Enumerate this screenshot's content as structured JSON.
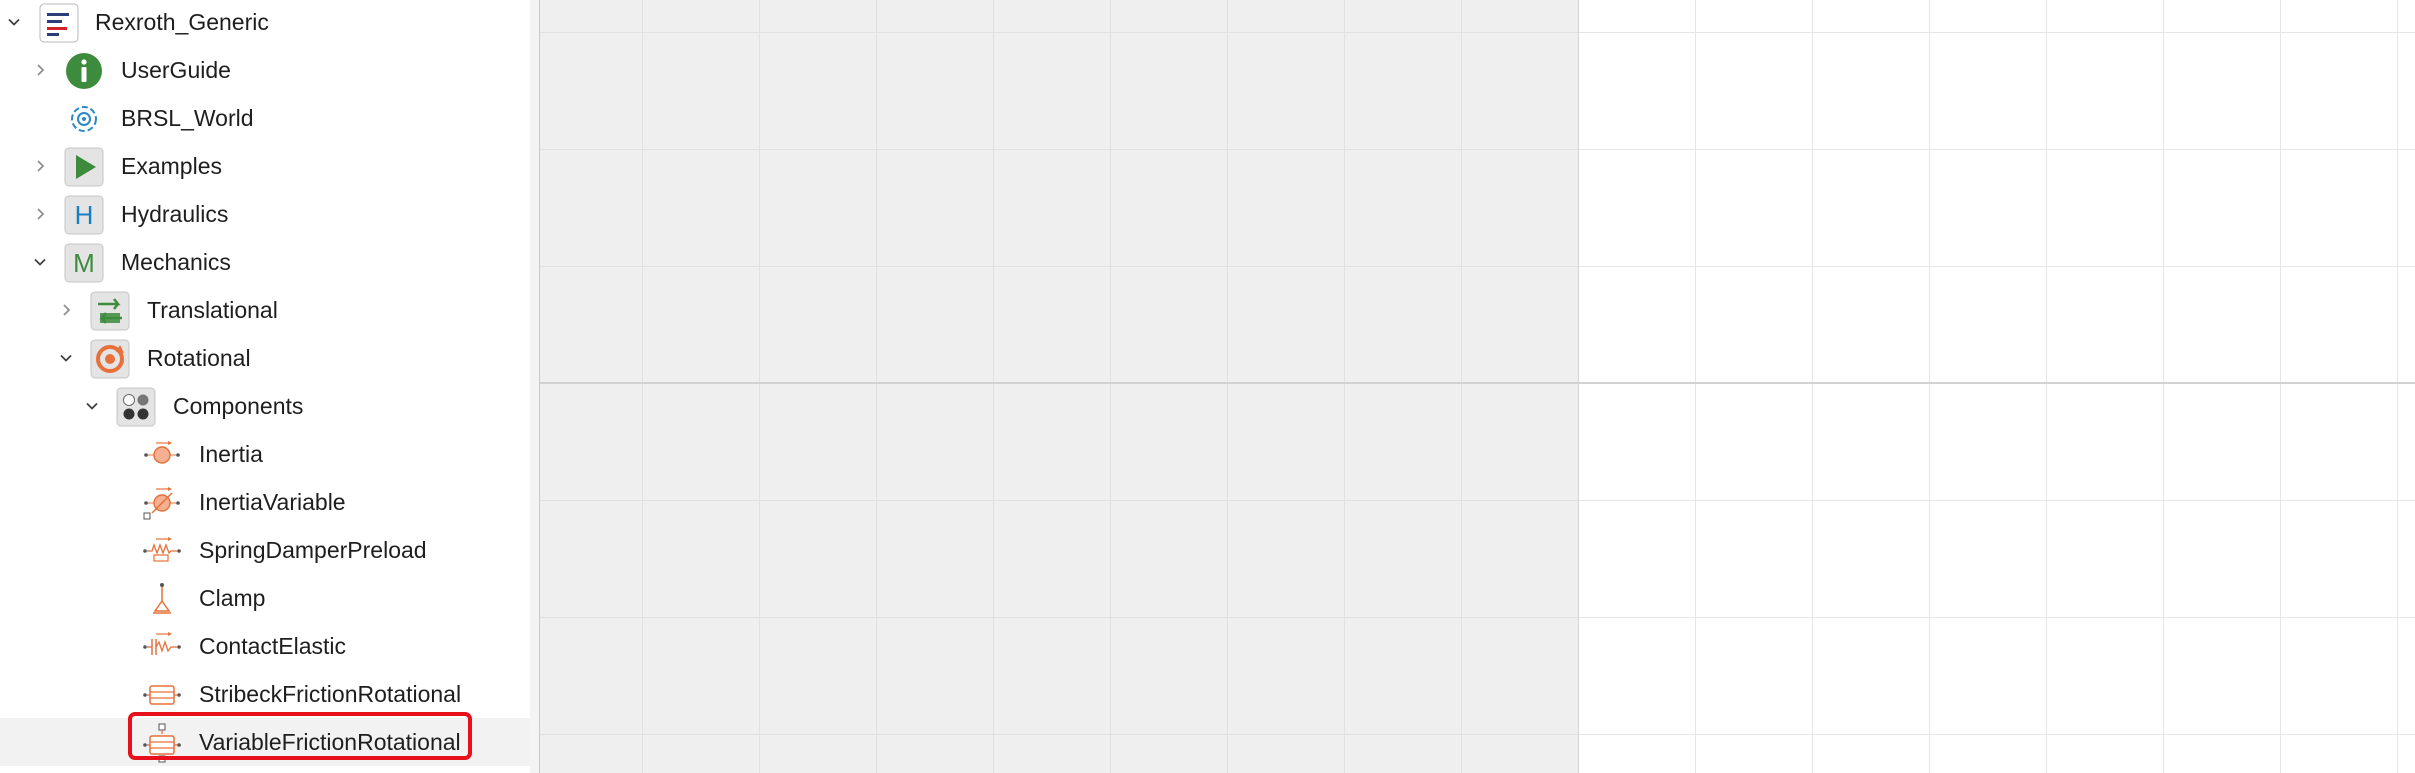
{
  "tree": {
    "items": [
      {
        "label": "Rexroth_Generic",
        "icon": "rexroth-library-icon",
        "expander": "expanded",
        "level": 0
      },
      {
        "label": "UserGuide",
        "icon": "info-icon",
        "expander": "collapsed",
        "level": 1
      },
      {
        "label": "BRSL_World",
        "icon": "world-icon",
        "expander": "none",
        "level": 1
      },
      {
        "label": "Examples",
        "icon": "play-icon",
        "expander": "collapsed",
        "level": 1
      },
      {
        "label": "Hydraulics",
        "icon": "hydraulics-h-icon",
        "expander": "collapsed",
        "level": 1
      },
      {
        "label": "Mechanics",
        "icon": "mechanics-m-icon",
        "expander": "expanded",
        "level": 1
      },
      {
        "label": "Translational",
        "icon": "translational-icon",
        "expander": "collapsed",
        "level": 2
      },
      {
        "label": "Rotational",
        "icon": "rotational-icon",
        "expander": "expanded",
        "level": 2
      },
      {
        "label": "Components",
        "icon": "components-icon",
        "expander": "expanded",
        "level": 3
      },
      {
        "label": "Inertia",
        "icon": "inertia-icon",
        "expander": "none",
        "level": 4
      },
      {
        "label": "InertiaVariable",
        "icon": "inertia-variable-icon",
        "expander": "none",
        "level": 4
      },
      {
        "label": "SpringDamperPreload",
        "icon": "spring-damper-icon",
        "expander": "none",
        "level": 4
      },
      {
        "label": "Clamp",
        "icon": "clamp-icon",
        "expander": "none",
        "level": 4
      },
      {
        "label": "ContactElastic",
        "icon": "contact-elastic-icon",
        "expander": "none",
        "level": 4
      },
      {
        "label": "StribeckFrictionRotational",
        "icon": "stribeck-friction-icon",
        "expander": "none",
        "level": 4
      },
      {
        "label": "VariableFrictionRotational",
        "icon": "variable-friction-icon",
        "expander": "none",
        "level": 4,
        "selected": true,
        "highlighted": true
      }
    ]
  },
  "colors": {
    "highlight_border": "#e8101c",
    "library_green": "#3d8b3d",
    "hydraulics_blue": "#1a7fc1",
    "component_orange": "#e8703a"
  }
}
